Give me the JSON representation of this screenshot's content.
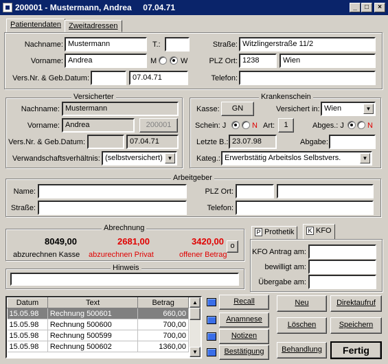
{
  "window": {
    "title": "200001 - Mustermann, Andrea     07.04.71",
    "min": "_",
    "max": "□",
    "close": "×"
  },
  "tabs_top": {
    "patient": "Patientendaten",
    "second": "Zweitadressen"
  },
  "patient": {
    "nachname_label": "Nachname:",
    "nachname": "Mustermann",
    "t_label": "T.:",
    "t_value": "",
    "vorname_label": "Vorname:",
    "vorname": "Andrea",
    "m_label": "M",
    "w_label": "W",
    "versnr_label": "Vers.Nr. & Geb.Datum:",
    "versnr": "",
    "gebdatum": "07.04.71",
    "strasse_label": "Straße:",
    "strasse": "Witzlingerstraße 11/2",
    "plz_label": "PLZ Ort:",
    "plz": "1238",
    "ort": "Wien",
    "telefon_label": "Telefon:",
    "telefon": ""
  },
  "versicherter": {
    "title": "Versicherter",
    "nachname_label": "Nachname:",
    "nachname": "Mustermann",
    "vorname_label": "Vorname:",
    "vorname": "Andrea",
    "id": "200001",
    "versnr_label": "Vers.Nr. & Geb.Datum:",
    "versnr": "",
    "gebdatum": "07.04.71",
    "verwandt_label": "Verwandschaftsverhältnis:",
    "verwandt": "(selbstversichert)"
  },
  "krankenschein": {
    "title": "Krankenschein",
    "kasse_label": "Kasse:",
    "kasse": "GN",
    "vers_in_label": "Versichert in:",
    "vers_in": "Wien",
    "schein_label": "Schein: J",
    "n_label": "N",
    "art_label": "Art:",
    "art": "1",
    "abges_label": "Abges.: J",
    "abges_n": "N",
    "letzte_label": "Letzte B.:",
    "letzte": "23.07.98",
    "abgabe_label": "Abgabe:",
    "abgabe": "",
    "kateg_label": "Kateg.:",
    "kateg": "Erwerbstätig Arbeitslos Selbstvers."
  },
  "arbeitgeber": {
    "title": "Arbeitgeber",
    "name_label": "Name:",
    "name": "",
    "plz_label": "PLZ Ort:",
    "plz": "",
    "ort": "",
    "strasse_label": "Straße:",
    "strasse": "",
    "telefon_label": "Telefon:",
    "telefon": ""
  },
  "abrechnung": {
    "title": "Abrechnung",
    "kasse_value": "8049,00",
    "kasse_label": "abzurechnen Kasse",
    "privat_value": "2681,00",
    "privat_label": "abzurechnen Privat",
    "offen_value": "3420,00",
    "offen_label": "offener Betrag",
    "o_button": "o"
  },
  "hinweis": {
    "title": "Hinweis",
    "value": ""
  },
  "side_tabs": {
    "prothetik": "Prothetik",
    "kfo": "KFO",
    "p_icon": "P",
    "k_icon": "K"
  },
  "kfo": {
    "antrag_label": "KFO Antrag am:",
    "antrag": "",
    "bewilligt_label": "bewilligt am:",
    "bewilligt": "",
    "uebergabe_label": "Übergabe am:",
    "uebergabe": ""
  },
  "table": {
    "headers": [
      "Datum",
      "Text",
      "Betrag"
    ],
    "rows": [
      [
        "15.05.98",
        "Rechnung 500601",
        "660,00"
      ],
      [
        "15.05.98",
        "Rechnung 500600",
        "700,00"
      ],
      [
        "15.05.98",
        "Rechnung 500599",
        "700,00"
      ],
      [
        "15.05.98",
        "Rechnung 500602",
        "1360,00"
      ]
    ]
  },
  "buttons": {
    "recall": "Recall",
    "anamnese": "Anamnese",
    "notizen": "Notizen",
    "bestaetigung": "Bestätigung",
    "neu": "Neu",
    "direktaufruf": "Direktaufruf",
    "loeschen": "Löschen",
    "speichern": "Speichern",
    "behandlung": "Behandlung",
    "fertig": "Fertig"
  }
}
